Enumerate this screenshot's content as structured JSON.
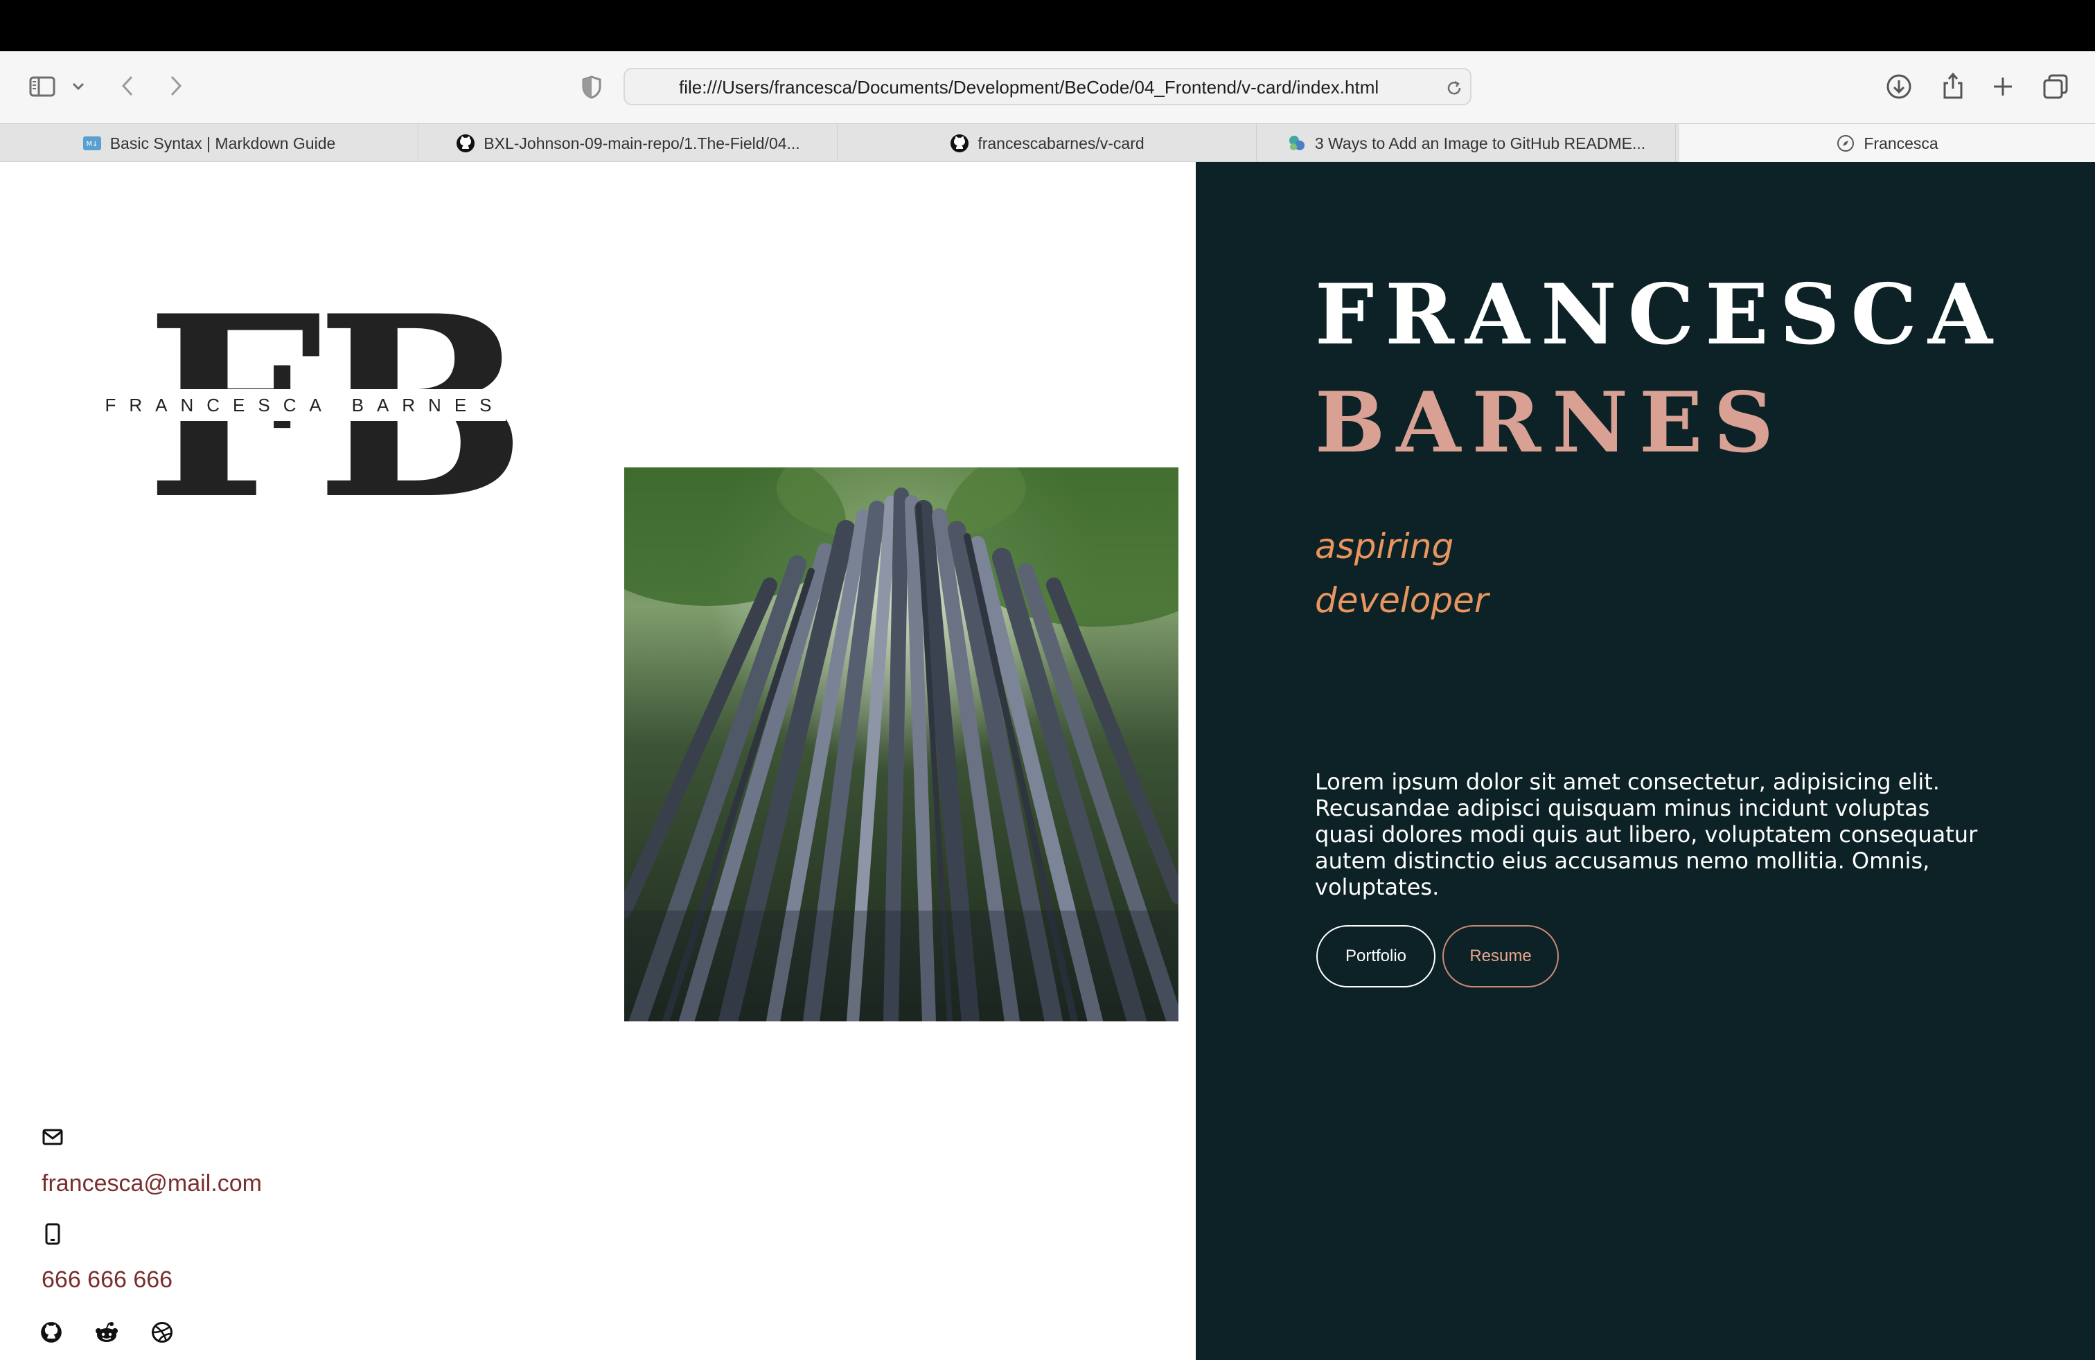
{
  "browser": {
    "url": "file:///Users/francesca/Documents/Development/BeCode/04_Frontend/v-card/index.html",
    "tabs": [
      {
        "label": "Basic Syntax | Markdown Guide",
        "icon": "markdown-icon"
      },
      {
        "label": "BXL-Johnson-09-main-repo/1.The-Field/04...",
        "icon": "github-icon"
      },
      {
        "label": "francescabarnes/v-card",
        "icon": "github-icon"
      },
      {
        "label": "3 Ways to Add an Image to GitHub README...",
        "icon": "site-favicon"
      },
      {
        "label": "Francesca",
        "icon": "compass-icon",
        "active": true
      }
    ]
  },
  "logo": {
    "letters": "FB",
    "name": "FRANCESCA BARNES"
  },
  "contact": {
    "email": "francesca@mail.com",
    "phone": "666 666 666",
    "socials": [
      "github-icon",
      "reddit-icon",
      "dribbble-icon"
    ]
  },
  "hero": {
    "first_name": "FRANCESCA",
    "last_name": "BARNES",
    "tagline_line1": "aspiring",
    "tagline_line2": "developer",
    "bio": "Lorem ipsum dolor sit amet consectetur, adipisicing elit. Recusandae adipisci quisquam minus incidunt voluptas quasi dolores modi quis aut libero, voluptatem consequatur autem distinctio eius accusamus nemo mollitia. Omnis, voluptates.",
    "buttons": {
      "portfolio": "Portfolio",
      "resume": "Resume"
    }
  },
  "colors": {
    "panel": "#0d2226",
    "accent_name": "#d9a194",
    "accent_tagline": "#e8955f",
    "contact_text": "#7a2e2e"
  }
}
